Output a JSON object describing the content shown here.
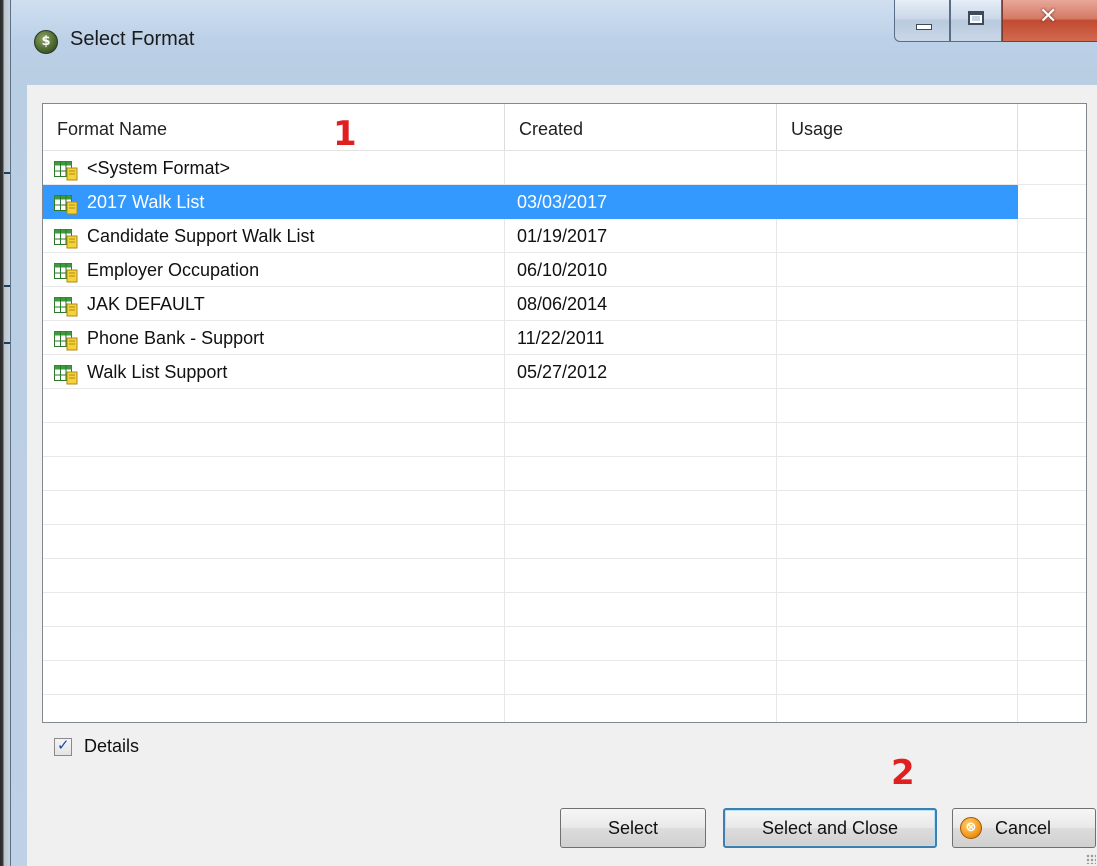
{
  "window": {
    "title": "Select Format",
    "controls": {
      "minimize": "minimize",
      "maximize": "maximize",
      "close": "close"
    }
  },
  "table": {
    "columns": [
      "Format Name",
      "Created",
      "Usage",
      ""
    ],
    "rows": [
      {
        "name": "<System Format>",
        "created": "",
        "usage": "",
        "selected": false
      },
      {
        "name": "2017 Walk List",
        "created": "03/03/2017",
        "usage": "",
        "selected": true
      },
      {
        "name": "Candidate Support Walk List",
        "created": "01/19/2017",
        "usage": "",
        "selected": false
      },
      {
        "name": "Employer Occupation",
        "created": "06/10/2010",
        "usage": "",
        "selected": false
      },
      {
        "name": "JAK DEFAULT",
        "created": "08/06/2014",
        "usage": "",
        "selected": false
      },
      {
        "name": "Phone Bank - Support",
        "created": "11/22/2011",
        "usage": "",
        "selected": false
      },
      {
        "name": "Walk List Support",
        "created": "05/27/2012",
        "usage": "",
        "selected": false
      },
      {
        "name": "",
        "created": "",
        "usage": "",
        "selected": false
      },
      {
        "name": "",
        "created": "",
        "usage": "",
        "selected": false
      },
      {
        "name": "",
        "created": "",
        "usage": "",
        "selected": false
      },
      {
        "name": "",
        "created": "",
        "usage": "",
        "selected": false
      },
      {
        "name": "",
        "created": "",
        "usage": "",
        "selected": false
      },
      {
        "name": "",
        "created": "",
        "usage": "",
        "selected": false
      },
      {
        "name": "",
        "created": "",
        "usage": "",
        "selected": false
      },
      {
        "name": "",
        "created": "",
        "usage": "",
        "selected": false
      },
      {
        "name": "",
        "created": "",
        "usage": "",
        "selected": false
      },
      {
        "name": "",
        "created": "",
        "usage": "",
        "selected": false
      }
    ]
  },
  "annotations": {
    "marker_1": "1",
    "marker_2": "2"
  },
  "details": {
    "label": "Details",
    "checked": true
  },
  "buttons": {
    "select": "Select",
    "select_and_close": "Select and Close",
    "cancel": "Cancel"
  },
  "icons": {
    "app": "app-globe-icon",
    "row": "table-grid-icon",
    "cancel": "cancel-circle-icon"
  },
  "colors": {
    "selection": "#3399ff",
    "marker": "#e02020",
    "default_button_border": "#3c7fb1"
  }
}
